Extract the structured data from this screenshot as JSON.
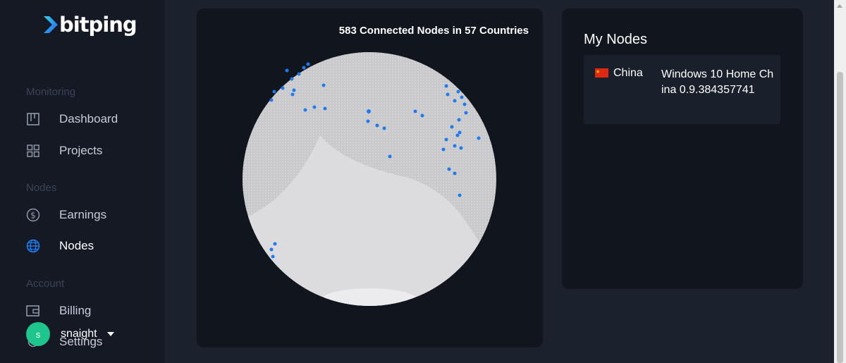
{
  "app": {
    "logo_text": "bitping",
    "accent_color": "#1e7bef"
  },
  "sidebar": {
    "sections": [
      {
        "label": "Monitoring",
        "items": [
          {
            "label": "Dashboard",
            "icon": "dashboard-icon"
          },
          {
            "label": "Projects",
            "icon": "grid-icon"
          }
        ]
      },
      {
        "label": "Nodes",
        "items": [
          {
            "label": "Earnings",
            "icon": "dollar-circle-icon"
          },
          {
            "label": "Nodes",
            "icon": "globe-icon",
            "active": true
          }
        ]
      },
      {
        "label": "Account",
        "items": [
          {
            "label": "Billing",
            "icon": "wallet-icon"
          },
          {
            "label": "Settings",
            "icon": "settings-icon"
          }
        ]
      }
    ],
    "user": {
      "avatar_letter": "s",
      "name": "snaight",
      "avatar_color": "#1ec58c"
    }
  },
  "globe": {
    "title": "583 Connected Nodes in 57 Countries"
  },
  "my_nodes": {
    "title": "My Nodes",
    "nodes": [
      {
        "country": "China",
        "flag": "china-flag-icon",
        "details": "Windows 10 Home China  0.9.384357741"
      }
    ]
  }
}
